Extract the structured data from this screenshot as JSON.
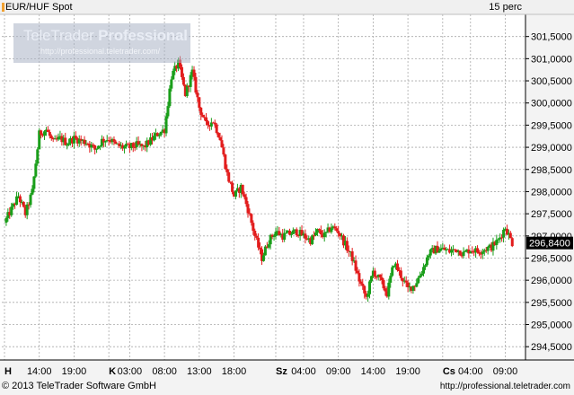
{
  "chart_data": {
    "type": "candlestick",
    "instrument": "EUR/HUF Spot",
    "interval": "15 perc",
    "ylim": [
      294.2,
      302.0
    ],
    "yticks": [
      "301,5000",
      "301,0000",
      "300,5000",
      "300,0000",
      "299,5000",
      "299,0000",
      "298,5000",
      "298,0000",
      "297,5000",
      "297,0000",
      "296,5000",
      "296,0000",
      "295,5000",
      "295,0000",
      "294,5000"
    ],
    "ytick_values": [
      301.5,
      301.0,
      300.5,
      300.0,
      299.5,
      299.0,
      298.5,
      298.0,
      297.5,
      297.0,
      296.5,
      296.0,
      295.5,
      295.0,
      294.5
    ],
    "last_value": 296.84,
    "last_value_label": "296,8400",
    "xticks": [
      {
        "text": "H",
        "bold": true,
        "day": true,
        "t": 0
      },
      {
        "text": "14:00",
        "t": 5
      },
      {
        "text": "19:00",
        "t": 10
      },
      {
        "text": "K",
        "bold": true,
        "day": true,
        "t": 15
      },
      {
        "text": "03:00",
        "t": 18
      },
      {
        "text": "08:00",
        "t": 23
      },
      {
        "text": "13:00",
        "t": 28
      },
      {
        "text": "18:00",
        "t": 33
      },
      {
        "text": "Sz",
        "bold": true,
        "day": true,
        "t": 39
      },
      {
        "text": "04:00",
        "t": 43
      },
      {
        "text": "09:00",
        "t": 48
      },
      {
        "text": "14:00",
        "t": 53
      },
      {
        "text": "19:00",
        "t": 58
      },
      {
        "text": "Cs",
        "bold": true,
        "day": true,
        "t": 63
      },
      {
        "text": "04:00",
        "t": 67
      },
      {
        "text": "09:00",
        "t": 72
      }
    ],
    "x_range": [
      0,
      74
    ],
    "close_series": [
      [
        0,
        297.3
      ],
      [
        1,
        297.6
      ],
      [
        2,
        297.9
      ],
      [
        3,
        297.5
      ],
      [
        4,
        298.0
      ],
      [
        5,
        299.3
      ],
      [
        6,
        299.4
      ],
      [
        7,
        299.1
      ],
      [
        8,
        299.2
      ],
      [
        9,
        299.1
      ],
      [
        10,
        299.2
      ],
      [
        11,
        299.15
      ],
      [
        12,
        299.1
      ],
      [
        13,
        298.95
      ],
      [
        14,
        299.15
      ],
      [
        15,
        299.2
      ],
      [
        16,
        299.05
      ],
      [
        17,
        299.0
      ],
      [
        18,
        299.0
      ],
      [
        19,
        299.05
      ],
      [
        20,
        299.0
      ],
      [
        21,
        299.15
      ],
      [
        22,
        299.3
      ],
      [
        23,
        299.4
      ],
      [
        24,
        300.6
      ],
      [
        25,
        300.9
      ],
      [
        26,
        300.2
      ],
      [
        27,
        300.7
      ],
      [
        28,
        299.9
      ],
      [
        29,
        299.5
      ],
      [
        30,
        299.6
      ],
      [
        31,
        299.2
      ],
      [
        32,
        298.4
      ],
      [
        33,
        297.9
      ],
      [
        34,
        298.1
      ],
      [
        35,
        297.6
      ],
      [
        36,
        297.0
      ],
      [
        37,
        296.5
      ],
      [
        38,
        296.9
      ],
      [
        39,
        297.1
      ],
      [
        40,
        297.0
      ],
      [
        41,
        297.05
      ],
      [
        42,
        297.1
      ],
      [
        43,
        297.0
      ],
      [
        44,
        296.9
      ],
      [
        45,
        297.1
      ],
      [
        46,
        297.0
      ],
      [
        47,
        297.2
      ],
      [
        48,
        297.1
      ],
      [
        49,
        296.8
      ],
      [
        50,
        296.5
      ],
      [
        51,
        296.0
      ],
      [
        52,
        295.6
      ],
      [
        53,
        296.2
      ],
      [
        54,
        296.0
      ],
      [
        55,
        295.7
      ],
      [
        56,
        296.4
      ],
      [
        57,
        296.1
      ],
      [
        58,
        295.8
      ],
      [
        59,
        295.9
      ],
      [
        60,
        296.2
      ],
      [
        61,
        296.6
      ],
      [
        62,
        296.7
      ],
      [
        63,
        296.7
      ],
      [
        64,
        296.65
      ],
      [
        65,
        296.7
      ],
      [
        66,
        296.6
      ],
      [
        67,
        296.7
      ],
      [
        68,
        296.65
      ],
      [
        69,
        296.7
      ],
      [
        70,
        296.75
      ],
      [
        71,
        296.9
      ],
      [
        72,
        297.2
      ],
      [
        73,
        296.84
      ]
    ],
    "grid": true,
    "colors": {
      "up": "#1a9e1a",
      "down": "#e21c1c",
      "grid": "#a9a9a9",
      "axis": "#000000",
      "last_bg": "#000000",
      "last_fg": "#ffffff"
    }
  },
  "header": {
    "instrument": "EUR/HUF Spot",
    "interval": "15 perc"
  },
  "watermark": {
    "brand_light": "TeleTrader",
    "brand_bold": "Professional",
    "url": "http://professional.teletrader.com/"
  },
  "footer": {
    "copyright": "© 2013 TeleTrader Software GmbH",
    "url": "http://professional.teletrader.com"
  }
}
